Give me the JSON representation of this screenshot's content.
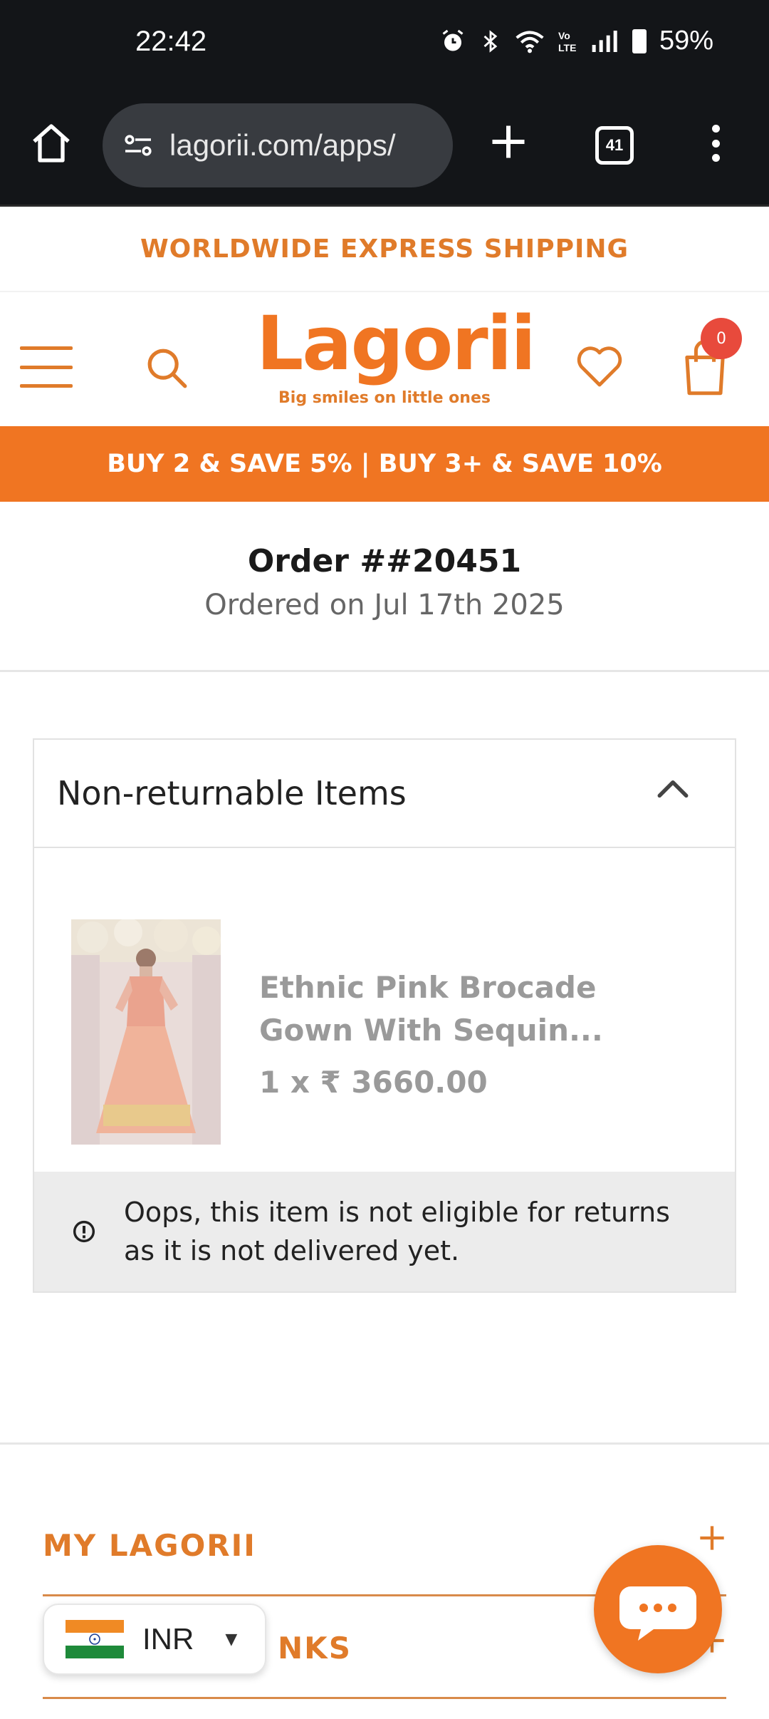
{
  "status_bar": {
    "time": "22:42",
    "battery": "59%"
  },
  "browser": {
    "url": "lagorii.com/apps/",
    "tab_count": "41"
  },
  "announcement": "WORLDWIDE EXPRESS SHIPPING",
  "header": {
    "logo_text": "Lagorii",
    "logo_tagline": "Big smiles on little ones",
    "cart_count": "0"
  },
  "promo": "BUY 2 & SAVE 5% | BUY 3+ & SAVE 10%",
  "order": {
    "title": "Order ##20451",
    "date": "Ordered on Jul 17th 2025"
  },
  "non_returnable": {
    "heading": "Non-returnable Items",
    "product_name": "Ethnic Pink Brocade Gown With Sequin...",
    "product_price": "1 x ₹ 3660.00",
    "notice": "Oops, this item is not eligible for returns as it is not delivered yet."
  },
  "footer": {
    "sections": [
      {
        "label": "MY LAGORII"
      },
      {
        "label": "NKS"
      }
    ]
  },
  "currency": {
    "code": "INR"
  },
  "colors": {
    "brand": "#f07522",
    "status_bar": "#131518",
    "notice_bg": "#ececec"
  },
  "icons": [
    "home-icon",
    "tune-icon",
    "plus-icon",
    "tabs-icon",
    "more-icon",
    "hamburger-icon",
    "search-icon",
    "heart-icon",
    "cart-icon",
    "chevron-up-icon",
    "alert-icon",
    "india-flag-icon",
    "chat-icon"
  ]
}
